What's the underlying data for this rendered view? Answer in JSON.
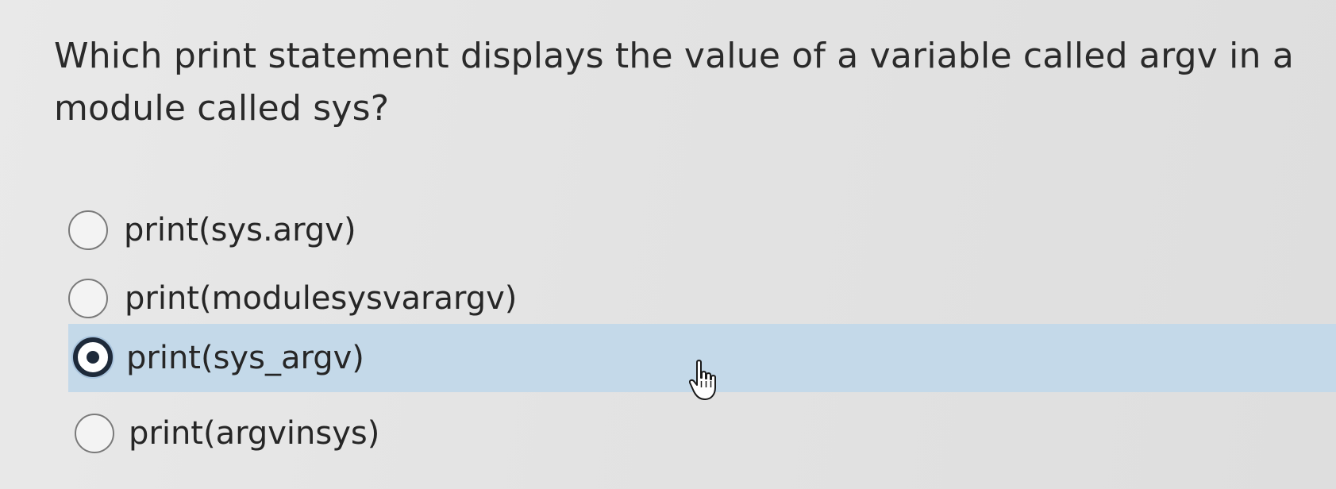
{
  "question": {
    "text": "Which print statement displays the value of a variable called argv in a module called sys?"
  },
  "options": [
    {
      "label": "print(sys.argv)",
      "selected": false
    },
    {
      "label": "print(modulesysvarargv)",
      "selected": false
    },
    {
      "label": "print(sys_argv)",
      "selected": true
    },
    {
      "label": "print(argvinsys)",
      "selected": false
    }
  ],
  "cursor": {
    "icon": "hand-pointer-icon"
  },
  "colors": {
    "background": "#e6e6e6",
    "selected_row": "#c4d9e9",
    "radio_checked": "#1e2a3a",
    "text": "#2b2b2b"
  }
}
